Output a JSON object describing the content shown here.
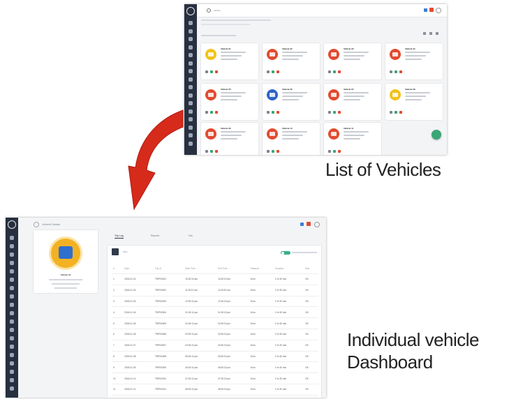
{
  "captions": {
    "list": "List of Vehicles",
    "dashboard_line1": "Individual vehicle",
    "dashboard_line2": "Dashboard"
  },
  "colors": {
    "arrow": "#d62a1b",
    "nav": "#283040",
    "fab": "#3aa675",
    "icon_red": "#e24a2f",
    "icon_blue": "#2e63c8",
    "icon_yellow": "#f3c21a"
  },
  "list_screen": {
    "search_placeholder": "Vehicle",
    "cards": [
      {
        "icon": "vehicle-icon-yellow",
        "name": "Vehicle 01"
      },
      {
        "icon": "vehicle-icon-red",
        "name": "Vehicle 02"
      },
      {
        "icon": "vehicle-icon-red",
        "name": "Vehicle 03"
      },
      {
        "icon": "vehicle-icon-red",
        "name": "Vehicle 04"
      },
      {
        "icon": "vehicle-icon-red",
        "name": "Vehicle 05"
      },
      {
        "icon": "vehicle-icon-blue",
        "name": "Vehicle 06"
      },
      {
        "icon": "vehicle-icon-red",
        "name": "Vehicle 07"
      },
      {
        "icon": "vehicle-icon-yellow",
        "name": "Vehicle 08"
      },
      {
        "icon": "vehicle-icon-red",
        "name": "Vehicle 09"
      },
      {
        "icon": "vehicle-icon-red",
        "name": "Vehicle 10"
      },
      {
        "icon": "vehicle-icon-red",
        "name": "Vehicle 11"
      }
    ]
  },
  "dashboard_screen": {
    "back_label": "Vehicle Details",
    "profile_name": "Vehicle 01",
    "tabs": [
      "Trip Log",
      "Reports",
      "Info"
    ],
    "filter_label": "Filter",
    "columns": [
      "#",
      "Date",
      "Trip ID",
      "Start Time",
      "End Time",
      "Distance",
      "Duration",
      "Stat"
    ],
    "rows": [
      [
        "1",
        "2018-01-01",
        "TRIP00001",
        "10:00:10 am",
        "10:30:20 am",
        "8 km",
        "0 hr 30 min",
        "OK"
      ],
      [
        "2",
        "2018-01-02",
        "TRIP00002",
        "11:00:10 am",
        "11:30:20 am",
        "8 km",
        "0 hr 30 min",
        "OK"
      ],
      [
        "3",
        "2018-01-03",
        "TRIP00003",
        "12:00:10 pm",
        "12:30:20 pm",
        "8 km",
        "0 hr 30 min",
        "OK"
      ],
      [
        "4",
        "2018-01-04",
        "TRIP00004",
        "01:00:10 pm",
        "01:30:20 pm",
        "8 km",
        "0 hr 30 min",
        "OK"
      ],
      [
        "5",
        "2018-01-05",
        "TRIP00005",
        "02:00:10 pm",
        "02:30:20 pm",
        "8 km",
        "0 hr 30 min",
        "OK"
      ],
      [
        "6",
        "2018-01-06",
        "TRIP00006",
        "03:00:10 pm",
        "03:30:20 pm",
        "8 km",
        "0 hr 30 min",
        "OK"
      ],
      [
        "7",
        "2018-01-07",
        "TRIP00007",
        "04:00:10 pm",
        "04:30:20 pm",
        "8 km",
        "0 hr 30 min",
        "OK"
      ],
      [
        "8",
        "2018-01-08",
        "TRIP00008",
        "05:00:10 pm",
        "05:30:20 pm",
        "8 km",
        "0 hr 30 min",
        "OK"
      ],
      [
        "9",
        "2018-01-09",
        "TRIP00009",
        "06:00:10 pm",
        "06:30:20 pm",
        "8 km",
        "0 hr 30 min",
        "OK"
      ],
      [
        "10",
        "2018-01-10",
        "TRIP00010",
        "07:00:10 pm",
        "07:30:20 pm",
        "8 km",
        "0 hr 30 min",
        "OK"
      ],
      [
        "11",
        "2018-01-11",
        "TRIP00011",
        "08:00:10 pm",
        "08:30:20 pm",
        "8 km",
        "0 hr 30 min",
        "OK"
      ],
      [
        "12",
        "2018-01-12",
        "TRIP00012",
        "09:00:10 pm",
        "09:30:20 pm",
        "8 km",
        "0 hr 30 min",
        "OK"
      ]
    ]
  }
}
